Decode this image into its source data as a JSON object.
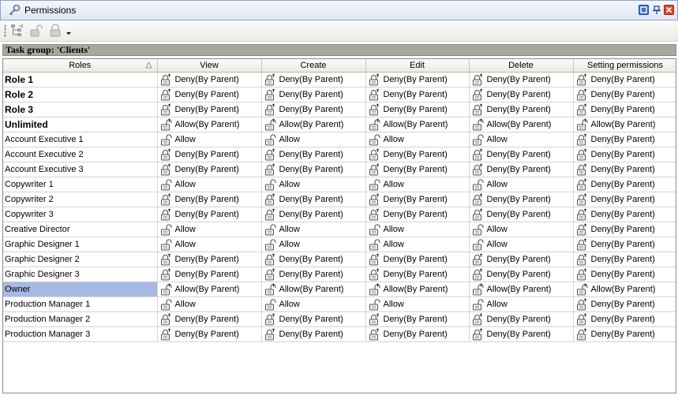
{
  "window": {
    "title": "Permissions"
  },
  "group": {
    "label": "Task group: 'Clients'"
  },
  "columns": [
    "Roles",
    "View",
    "Create",
    "Edit",
    "Delete",
    "Setting permissions"
  ],
  "labels": {
    "deny": "Deny(By Parent)",
    "allow_parent": "Allow(By Parent)",
    "allow": "Allow"
  },
  "rows": [
    {
      "role": "Role 1",
      "bold": true,
      "cells": [
        "deny",
        "deny",
        "deny",
        "deny",
        "deny"
      ]
    },
    {
      "role": "Role 2",
      "bold": true,
      "cells": [
        "deny",
        "deny",
        "deny",
        "deny",
        "deny"
      ]
    },
    {
      "role": "Role 3",
      "bold": true,
      "cells": [
        "deny",
        "deny",
        "deny",
        "deny",
        "deny"
      ]
    },
    {
      "role": "Unlimited",
      "bold": true,
      "cells": [
        "allow_parent",
        "allow_parent",
        "allow_parent",
        "allow_parent",
        "allow_parent"
      ]
    },
    {
      "role": "Account Executive 1",
      "cells": [
        "allow",
        "allow",
        "allow",
        "allow",
        "deny"
      ]
    },
    {
      "role": "Account Executive 2",
      "cells": [
        "deny",
        "deny",
        "deny",
        "deny",
        "deny"
      ]
    },
    {
      "role": "Account Executive 3",
      "cells": [
        "deny",
        "deny",
        "deny",
        "deny",
        "deny"
      ]
    },
    {
      "role": "Copywriter 1",
      "cells": [
        "allow",
        "allow",
        "allow",
        "allow",
        "deny"
      ]
    },
    {
      "role": "Copywriter 2",
      "cells": [
        "deny",
        "deny",
        "deny",
        "deny",
        "deny"
      ]
    },
    {
      "role": "Copywriter 3",
      "cells": [
        "deny",
        "deny",
        "deny",
        "deny",
        "deny"
      ]
    },
    {
      "role": "Creative Director",
      "cells": [
        "allow",
        "allow",
        "allow",
        "allow",
        "deny"
      ]
    },
    {
      "role": "Graphic Designer 1",
      "cells": [
        "allow",
        "allow",
        "allow",
        "allow",
        "deny"
      ]
    },
    {
      "role": "Graphic Designer 2",
      "cells": [
        "deny",
        "deny",
        "deny",
        "deny",
        "deny"
      ]
    },
    {
      "role": "Graphic Designer 3",
      "cells": [
        "deny",
        "deny",
        "deny",
        "deny",
        "deny"
      ]
    },
    {
      "role": "Owner",
      "selected": true,
      "cells": [
        "allow_parent",
        "allow_parent",
        "allow_parent",
        "allow_parent",
        "allow_parent"
      ]
    },
    {
      "role": "Production Manager 1",
      "cells": [
        "allow",
        "allow",
        "allow",
        "allow",
        "deny"
      ]
    },
    {
      "role": "Production Manager 2",
      "cells": [
        "deny",
        "deny",
        "deny",
        "deny",
        "deny"
      ]
    },
    {
      "role": "Production Manager 3",
      "cells": [
        "deny",
        "deny",
        "deny",
        "deny",
        "deny"
      ]
    }
  ],
  "icons": {
    "title": "key-icon",
    "toolbar": [
      "tree-view-icon",
      "unlock-icon",
      "lock-icon"
    ],
    "deny": "lock-inherited-icon",
    "allow_parent": "unlock-inherited-icon",
    "allow": "unlock-icon"
  },
  "colors": {
    "selected_row": "#a6b9e4",
    "group_bar": "#a9a89d"
  }
}
